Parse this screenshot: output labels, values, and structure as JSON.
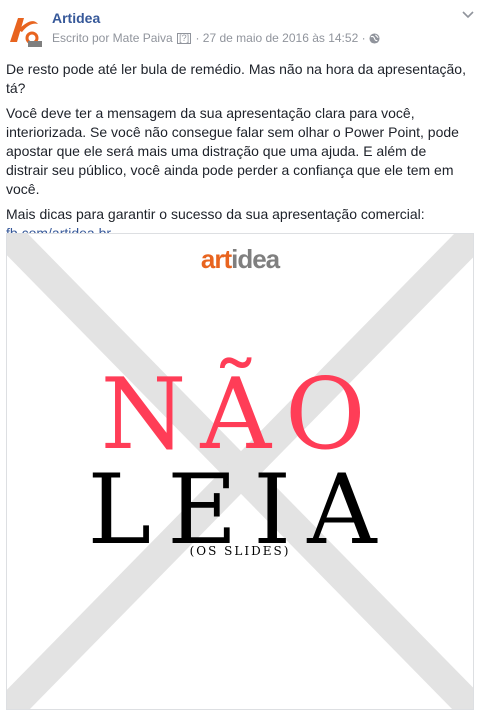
{
  "post": {
    "page_name": "Artidea",
    "written_by": "Escrito por Mate Paiva",
    "help_badge": "?",
    "timestamp": "· 27 de maio de 2016 às 14:52 ·",
    "paragraphs": [
      "De resto pode até ler bula de remédio. Mas não na hora da apresentação, tá?",
      "Você deve ter a mensagem da sua apresentação clara para você, interiorizada. Se você não consegue falar sem olhar o Power Point, pode apostar que ele será mais uma distração que uma ajuda. E além de distrair seu público, você ainda pode perder a confiança que ele tem em você.",
      "Mais dicas para garantir o sucesso da sua apresentação comercial:"
    ],
    "link": "fb.com/artidea.br"
  },
  "photo": {
    "brand_art": "art",
    "brand_idea": "idea",
    "line1": "NÃO",
    "line2": "LEIA",
    "line3": "(OS SLIDES)"
  },
  "colors": {
    "link": "#365899",
    "meta": "#90949c",
    "accent_red": "#ff3d57",
    "brand_orange": "#e8641f"
  },
  "icons": [
    "artidea-logo",
    "globe-icon",
    "chevron-down-icon"
  ]
}
